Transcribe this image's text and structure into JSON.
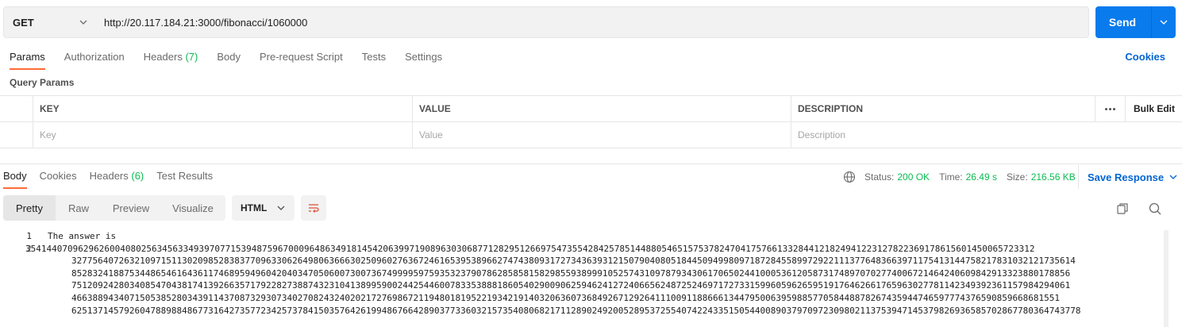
{
  "request": {
    "method": "GET",
    "url": "http://20.117.184.21:3000/fibonacci/1060000",
    "send_label": "Send"
  },
  "request_tabs": {
    "params": "Params",
    "authorization": "Authorization",
    "headers": "Headers",
    "headers_count": "(7)",
    "body": "Body",
    "pre_request": "Pre-request Script",
    "tests": "Tests",
    "settings": "Settings",
    "cookies": "Cookies"
  },
  "query_params": {
    "title": "Query Params",
    "columns": {
      "key": "KEY",
      "value": "VALUE",
      "description": "DESCRIPTION",
      "bulk_edit": "Bulk Edit"
    },
    "placeholders": {
      "key": "Key",
      "value": "Value",
      "description": "Description"
    }
  },
  "response_tabs": {
    "body": "Body",
    "cookies": "Cookies",
    "headers": "Headers",
    "headers_count": "(6)",
    "test_results": "Test Results"
  },
  "response_meta": {
    "status_label": "Status:",
    "status_value": "200 OK",
    "time_label": "Time:",
    "time_value": "26.49 s",
    "size_label": "Size:",
    "size_value": "216.56 KB",
    "save_response": "Save Response"
  },
  "view_modes": {
    "pretty": "Pretty",
    "raw": "Raw",
    "preview": "Preview",
    "visualize": "Visualize",
    "format": "HTML"
  },
  "response_body": {
    "line_numbers": [
      "1",
      "2"
    ],
    "line1": "The answer is",
    "line2_first": "354144070962962600408025634563349397077153948759670009648634918145420639971908963030687712829512669754735542842578514488054651575378247041757661332844121824941223127822369178615601450065723312",
    "line2_cont": [
      "32775640726321097151130209852838377096330626498063666302509602763672461653953896627474380931727343639312150790408051844509499809718728455899729221113776483663971175413144758217831032121735614",
      "8528324188753448654616436117468959496042040347050600730073674999959759353237907862858581582985593899910525743109787934306170650244100053612058731748970702774006721464240609842913323880178856",
      "7512092428034085470438174139266357179228273887432310413899590024425446007833538881860540290090625946241272406656248725246971727331599605962659519176462661765963027781142349392361157984294061",
      "46638894340715053852803439114370873293073402708243240202172769867211948018195221934219140320636073684926712926411100911886661344795006395988577058448878267435944746597774376590859668681551"
    ],
    "line2_tail": "625137145792604788988486773164273577234257378415035764261994867664289037733603215735408068217112890249200528953725540742243351505440089037970972309802113753947145379826936585702867780364743778"
  }
}
